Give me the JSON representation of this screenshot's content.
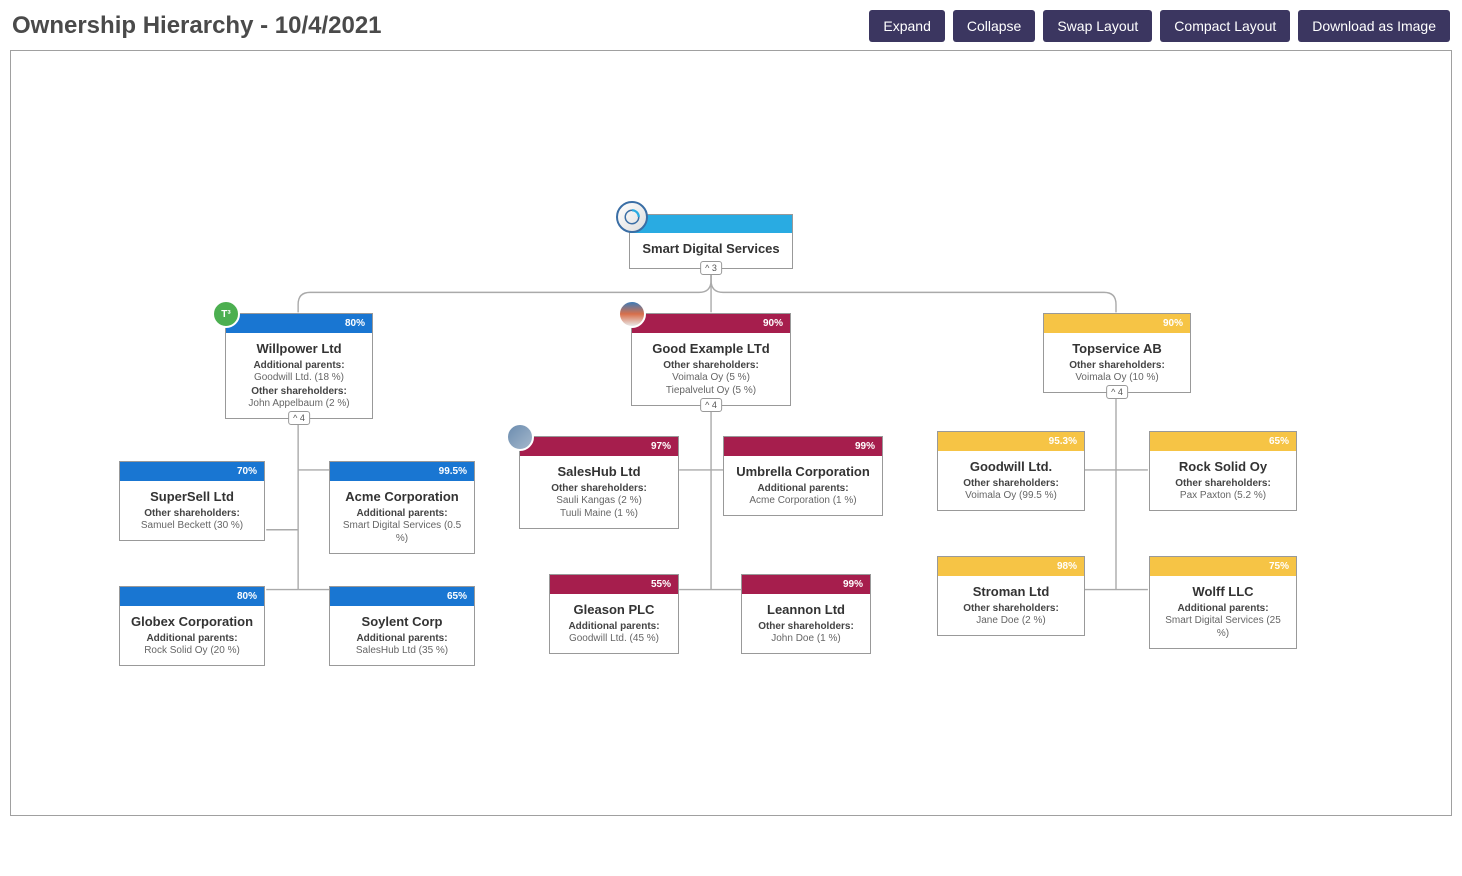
{
  "page": {
    "title": "Ownership Hierarchy - 10/4/2021"
  },
  "toolbar": {
    "expand": "Expand",
    "collapse": "Collapse",
    "swap_layout": "Swap Layout",
    "compact_layout": "Compact Layout",
    "download": "Download as Image"
  },
  "icons": {
    "willpower_badge": "T³"
  },
  "counts": {
    "root": "^ 3",
    "willpower": "^ 4",
    "good_example": "^ 4",
    "topservice": "^ 4"
  },
  "nodes": {
    "root": {
      "name": "Smart Digital Services"
    },
    "willpower": {
      "pct": "80%",
      "name": "Willpower Ltd",
      "lbl1": "Additional parents:",
      "det1": "Goodwill Ltd. (18 %)",
      "lbl2": "Other shareholders:",
      "det2": "John Appelbaum (2 %)"
    },
    "supersell": {
      "pct": "70%",
      "name": "SuperSell Ltd",
      "lbl1": "Other shareholders:",
      "det1": "Samuel Beckett (30 %)"
    },
    "acme": {
      "pct": "99.5%",
      "name": "Acme Corporation",
      "lbl1": "Additional parents:",
      "det1": "Smart Digital Services (0.5 %)"
    },
    "globex": {
      "pct": "80%",
      "name": "Globex Corporation",
      "lbl1": "Additional parents:",
      "det1": "Rock Solid Oy (20 %)"
    },
    "soylent": {
      "pct": "65%",
      "name": "Soylent Corp",
      "lbl1": "Additional parents:",
      "det1": "SalesHub Ltd (35 %)"
    },
    "good_example": {
      "pct": "90%",
      "name": "Good Example LTd",
      "lbl1": "Other shareholders:",
      "det1": "Voimala Oy (5 %)",
      "det1b": "Tiepalvelut Oy (5 %)"
    },
    "saleshub": {
      "pct": "97%",
      "name": "SalesHub Ltd",
      "lbl1": "Other shareholders:",
      "det1": "Sauli Kangas (2 %)",
      "det1b": "Tuuli Maine (1 %)"
    },
    "umbrella": {
      "pct": "99%",
      "name": "Umbrella Corporation",
      "lbl1": "Additional parents:",
      "det1": "Acme Corporation (1 %)"
    },
    "gleason": {
      "pct": "55%",
      "name": "Gleason PLC",
      "lbl1": "Additional parents:",
      "det1": "Goodwill Ltd. (45 %)"
    },
    "leannon": {
      "pct": "99%",
      "name": "Leannon Ltd",
      "lbl1": "Other shareholders:",
      "det1": "John Doe (1 %)"
    },
    "topservice": {
      "pct": "90%",
      "name": "Topservice AB",
      "lbl1": "Other shareholders:",
      "det1": "Voimala Oy (10 %)"
    },
    "goodwill": {
      "pct": "95.3%",
      "name": "Goodwill Ltd.",
      "lbl1": "Other shareholders:",
      "det1": "Voimala Oy (99.5 %)"
    },
    "rocksolid": {
      "pct": "65%",
      "name": "Rock Solid Oy",
      "lbl1": "Other shareholders:",
      "det1": "Pax Paxton (5.2 %)"
    },
    "stroman": {
      "pct": "98%",
      "name": "Stroman Ltd",
      "lbl1": "Other shareholders:",
      "det1": "Jane Doe (2 %)"
    },
    "wolff": {
      "pct": "75%",
      "name": "Wolff LLC",
      "lbl1": "Additional parents:",
      "det1": "Smart Digital Services (25 %)"
    }
  }
}
